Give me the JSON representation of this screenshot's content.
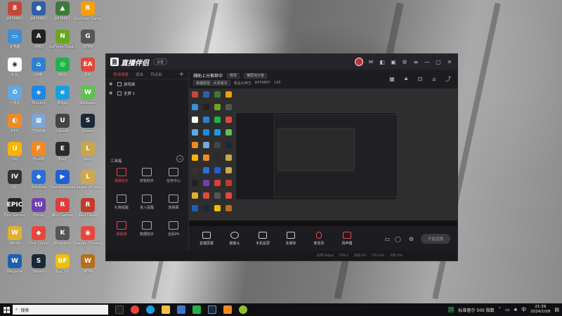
{
  "desktop": {
    "icons": [
      {
        "label": "8478887",
        "color": "#c4463a",
        "glyph": "8"
      },
      {
        "label": "8478887",
        "color": "#2f5fa8",
        "glyph": "●"
      },
      {
        "label": "8478887",
        "color": "#3d7a3b",
        "glyph": "▲"
      },
      {
        "label": "Rockstar Games",
        "color": "#f5a000",
        "glyph": "R"
      },
      {
        "label": "此电脑",
        "color": "#3a8fd6",
        "glyph": "▭"
      },
      {
        "label": "AMD",
        "color": "#222",
        "glyph": "A"
      },
      {
        "label": "GeForce Experience",
        "color": "#6aa51f",
        "glyph": "N"
      },
      {
        "label": "GTA5",
        "color": "#555",
        "glyph": "G"
      },
      {
        "label": "机机",
        "color": "#fff",
        "glyph": "◉"
      },
      {
        "label": "网络",
        "color": "#2f7fd0",
        "glyph": "⌂"
      },
      {
        "label": "微信",
        "color": "#21b14b",
        "glyph": "◎"
      },
      {
        "label": "EA",
        "color": "#e0473a",
        "glyph": "EA"
      },
      {
        "label": "回收站",
        "color": "#5fa9e6",
        "glyph": "♻"
      },
      {
        "label": "Tencent",
        "color": "#1e88e5",
        "glyph": "◈"
      },
      {
        "label": "Edge",
        "color": "#1b9de2",
        "glyph": "e"
      },
      {
        "label": "Wallpaper",
        "color": "#60c050",
        "glyph": "W"
      },
      {
        "label": "RE5",
        "color": "#f08a24",
        "glyph": "◐"
      },
      {
        "label": "控制面板",
        "color": "#7aa6d8",
        "glyph": "▦"
      },
      {
        "label": "Ubisoft",
        "color": "#444",
        "glyph": "U"
      },
      {
        "label": "Steam",
        "color": "#1b2838",
        "glyph": "S"
      },
      {
        "label": "UU",
        "color": "#ffb300",
        "glyph": "U"
      },
      {
        "label": "FiveM",
        "color": "#f08a24",
        "glyph": "F"
      },
      {
        "label": "Epic",
        "color": "#2b2b2b",
        "glyph": "E"
      },
      {
        "label": "LoL",
        "color": "#c9a64a",
        "glyph": "L"
      },
      {
        "label": "IV",
        "color": "#333",
        "glyph": "IV"
      },
      {
        "label": "Rainbow",
        "color": "#2b6fd6",
        "glyph": "◆"
      },
      {
        "label": "GameViewer",
        "color": "#1e60d4",
        "glyph": "▶"
      },
      {
        "label": "League of Legends",
        "color": "#cfa84e",
        "glyph": "L"
      },
      {
        "label": "Epic Games",
        "color": "#222",
        "glyph": "EPIC"
      },
      {
        "label": "Forza",
        "color": "#7040b0",
        "glyph": "tU"
      },
      {
        "label": "Riot Games",
        "color": "#e03b3b",
        "glyph": "R"
      },
      {
        "label": "Red Dead",
        "color": "#c23a2a",
        "glyph": "R"
      },
      {
        "label": "WoW",
        "color": "#e0b030",
        "glyph": "W"
      },
      {
        "label": "Riot Client",
        "color": "#e8453c",
        "glyph": "◆"
      },
      {
        "label": "Kingdom",
        "color": "#555",
        "glyph": "K"
      },
      {
        "label": "Google Chrome",
        "color": "#e8453c",
        "glyph": "◉"
      },
      {
        "label": "Wegame",
        "color": "#1f5fb0",
        "glyph": "W"
      },
      {
        "label": "Steam",
        "color": "#1b2838",
        "glyph": "S"
      },
      {
        "label": "极品飞车",
        "color": "#f0c000",
        "glyph": "BF"
      },
      {
        "label": "WOW",
        "color": "#b86e1a",
        "glyph": "W"
      }
    ]
  },
  "app": {
    "logo_name": "直播伴侣",
    "badge": "设置",
    "sidebar": {
      "tabs": [
        "常用场景",
        "双击",
        "可点击"
      ],
      "add": "+",
      "scenes": [
        "游戏画",
        "全屏 1"
      ],
      "toolbox_title": "工具箱",
      "tools_row1": [
        "弹幕助手",
        "房管助手",
        "任务中心"
      ],
      "tools_row2": [
        "礼物提醒",
        "进入提醒",
        "连弹幕"
      ],
      "tools_row3": [
        "弹幕墙",
        "数据助手",
        "全民PK"
      ]
    },
    "header": {
      "title": "辅助上分推荐中",
      "tag1": "修改",
      "tag2": "横屏加分板",
      "tag3": "英雄联盟 · 大师桌手",
      "text1": "我是大神王",
      "id": "8478887",
      "fans": "145"
    },
    "controls": [
      {
        "label": "直播屏幕"
      },
      {
        "label": "摄像头"
      },
      {
        "label": "手机投屏"
      },
      {
        "label": "多媒体"
      },
      {
        "label": "麦克风"
      },
      {
        "label": "扬声器"
      }
    ],
    "go_live": "开始直播",
    "status": [
      "码率:0kbps",
      "FPS:0",
      "丢帧:0%",
      "CPU:0%",
      "内存:0%"
    ]
  },
  "taskbar": {
    "search_placeholder": "搜索",
    "tray_text": "标准普尔 500 指数",
    "time": "21:39",
    "date": "2024/10/8"
  }
}
